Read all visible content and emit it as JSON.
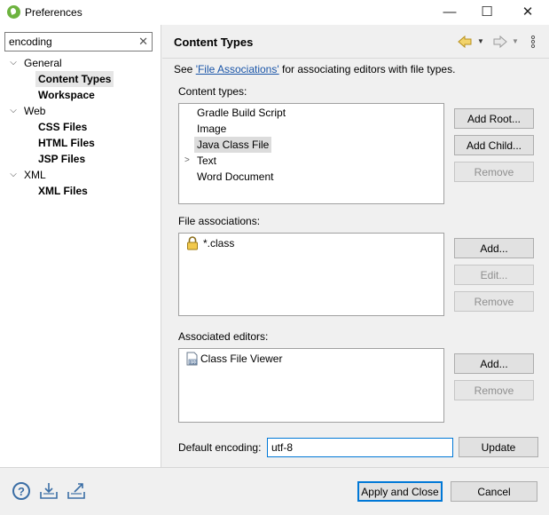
{
  "window": {
    "title": "Preferences",
    "buttons": {
      "minimize": "—",
      "maximize": "☐",
      "close": "✕"
    }
  },
  "filter": {
    "value": "encoding",
    "clear_icon": "✕"
  },
  "tree": [
    {
      "label": "General",
      "expanded": true,
      "children": [
        {
          "label": "Content Types",
          "selected": true
        },
        {
          "label": "Workspace"
        }
      ]
    },
    {
      "label": "Web",
      "expanded": true,
      "children": [
        {
          "label": "CSS Files"
        },
        {
          "label": "HTML Files"
        },
        {
          "label": "JSP Files"
        }
      ]
    },
    {
      "label": "XML",
      "expanded": true,
      "children": [
        {
          "label": "XML Files"
        }
      ]
    }
  ],
  "page": {
    "title": "Content Types",
    "description_prefix": "See ",
    "description_link": "'File Associations'",
    "description_suffix": " for associating editors with file types."
  },
  "content_types": {
    "label": "Content types:",
    "items": [
      {
        "label": "Gradle Build Script"
      },
      {
        "label": "Image"
      },
      {
        "label": "Java Class File",
        "selected": true
      },
      {
        "label": "Text",
        "expandable": true
      },
      {
        "label": "Word Document"
      }
    ],
    "buttons": {
      "add_root": "Add Root...",
      "add_child": "Add Child...",
      "remove": "Remove"
    }
  },
  "file_associations": {
    "label": "File associations:",
    "items": [
      {
        "label": "*.class",
        "icon": "lock-icon"
      }
    ],
    "buttons": {
      "add": "Add...",
      "edit": "Edit...",
      "remove": "Remove"
    }
  },
  "associated_editors": {
    "label": "Associated editors:",
    "items": [
      {
        "label": "Class File Viewer",
        "icon": "class-file-icon"
      }
    ],
    "buttons": {
      "add": "Add...",
      "remove": "Remove"
    }
  },
  "encoding": {
    "label": "Default encoding:",
    "value": "utf-8",
    "update": "Update"
  },
  "footer": {
    "apply_close": "Apply and Close",
    "cancel": "Cancel",
    "help_icon": "?"
  },
  "colors": {
    "accent": "#0078d7",
    "link": "#1a55a8",
    "nav_arrow": "#c9a227"
  }
}
